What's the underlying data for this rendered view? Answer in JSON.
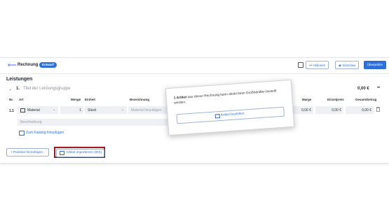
{
  "header": {
    "back_icon": "arrow-left-icon",
    "title": "Rechnung",
    "badge": "Entwurf",
    "actions_label": "Aktionen",
    "preview_label": "Vorschau",
    "check_label": "Überprüfen"
  },
  "section": {
    "title": "Leistungen"
  },
  "group": {
    "number": "1.",
    "title": "Titel der Leistungsgruppe",
    "total": "0,00 €",
    "more": "•••"
  },
  "columns": {
    "nr": "Nr.",
    "art": "Art",
    "menge": "Menge",
    "einheit": "Einheit",
    "bezeichnung": "Bezeichnung",
    "marge": "Marge",
    "einzelpreis": "Einzelpreis",
    "gesamtbetrag": "Gesamtbetrag"
  },
  "row": {
    "nr": "1.1",
    "art": "Material",
    "menge": "1",
    "einheit": "Stück",
    "bezeichnung_placeholder": "Material hinzufügen",
    "marge": "0,00 €",
    "einzelpreis": "0,00 €",
    "gesamtbetrag": "0,00 €",
    "beschreibung_placeholder": "Beschreibung"
  },
  "catalog_link": "Zum Katalog hinzufügen",
  "add_position": "+ Position hinzufügen",
  "import_articles": "Artikel importieren (IDS)",
  "popup": {
    "count": "1 Artikel",
    "message_rest": " aus dieser Rechnung kann direkt beim Großhändler bestellt werden.",
    "button": "Artikel bestellen"
  }
}
